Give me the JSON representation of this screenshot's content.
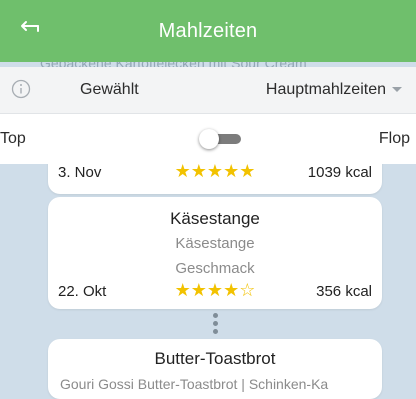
{
  "header": {
    "title": "Mahlzeiten",
    "ghost_text": "Gebackene Kartoffelecken mit Sour Cream"
  },
  "filter": {
    "label": "Gewählt",
    "selected_value": "Hauptmahlzeiten"
  },
  "toggle_row": {
    "left_label": "Top",
    "right_label": "Flop",
    "state": "off"
  },
  "meals": [
    {
      "name": "",
      "subtitle": "",
      "date": "3. Nov",
      "stars": "★★★★★",
      "rating": 5,
      "kcal": "1039 kcal"
    },
    {
      "name": "Käsestange",
      "subtitle": "Käsestange",
      "category": "Geschmack",
      "date": "22. Okt",
      "stars": "★★★★☆",
      "rating": 4,
      "kcal": "356 kcal"
    },
    {
      "name": "Butter-Toastbrot",
      "subtitle": "Gouri Gossi Butter-Toastbrot | Schinken-Ka"
    }
  ],
  "colors": {
    "header_bg": "#6fbf6c",
    "star": "#f2c200",
    "page_bg": "#cfdde9"
  }
}
